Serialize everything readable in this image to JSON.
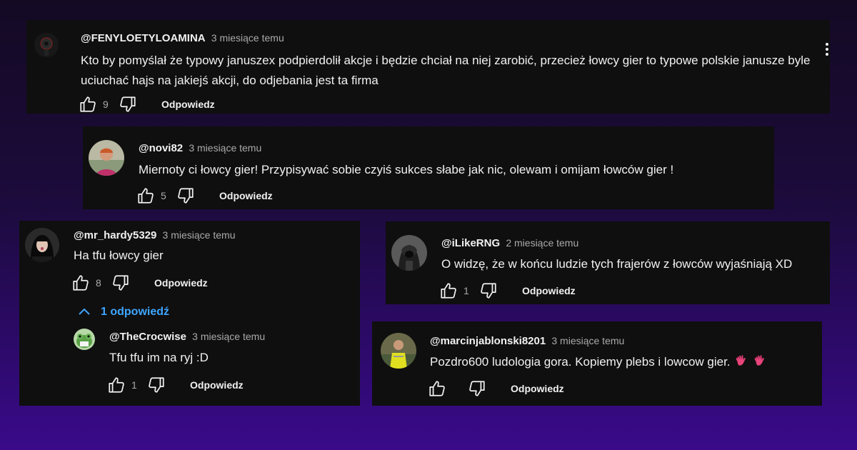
{
  "comments": [
    {
      "author": "@FENYLOETYLOAMINA",
      "time": "3 miesiące temu",
      "text": "Kto by pomyślał że typowy januszex podpierdolił akcje i będzie chciał na niej zarobić, przecież łowcy gier to typowe polskie janusze byle uciuchać hajs na jakiejś akcji, do odjebania jest ta firma",
      "likes": "9",
      "reply_label": "Odpowiedz"
    },
    {
      "author": "@novi82",
      "time": "3 miesiące temu",
      "text": "Miernoty ci łowcy gier! Przypisywać sobie czyiś sukces słabe jak nic, olewam i omijam łowców gier !",
      "likes": "5",
      "reply_label": "Odpowiedz"
    },
    {
      "author": "@mr_hardy5329",
      "time": "3 miesiące temu",
      "text": "Ha tfu łowcy gier",
      "likes": "8",
      "reply_label": "Odpowiedz",
      "replies_toggle": "1 odpowiedź",
      "reply": {
        "author": "@TheCrocwise",
        "time": "3 miesiące temu",
        "text": "Tfu tfu im na ryj :D",
        "likes": "1",
        "reply_label": "Odpowiedz"
      }
    },
    {
      "author": "@iLikeRNG",
      "time": "2 miesiące temu",
      "text": "O widzę, że w końcu ludzie tych frajerów z łowców wyjaśniają XD",
      "likes": "1",
      "reply_label": "Odpowiedz"
    },
    {
      "author": "@marcinjablonski8201",
      "time": "3 miesiące temu",
      "text": "Pozdro600 ludologia gora. Kopiemy plebs i lowcow gier.",
      "likes": "",
      "reply_label": "Odpowiedz"
    }
  ],
  "colors": {
    "card_bg": "#0f0f0f",
    "link_blue": "#3ea6ff",
    "muted": "#aaaaaa",
    "emoji_pink": "#e8457a"
  },
  "icons": [
    "thumbs-up-icon",
    "thumbs-down-icon",
    "more-vert-icon",
    "chevron-up-icon",
    "waving-hand-emoji"
  ]
}
